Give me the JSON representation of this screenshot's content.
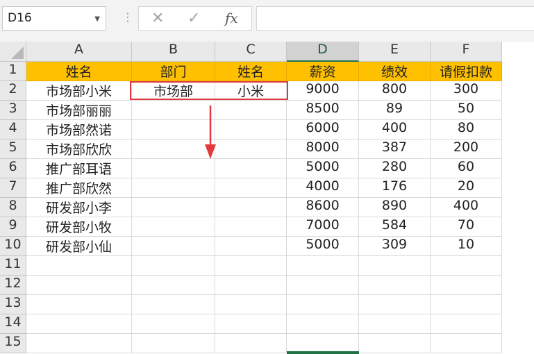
{
  "formula_bar": {
    "name_box": "D16",
    "separator": "⋮",
    "cancel_icon": "✕",
    "enter_icon": "✓",
    "fx_label": "fx",
    "formula": ""
  },
  "columns": [
    "A",
    "B",
    "C",
    "D",
    "E",
    "F"
  ],
  "selected_column": "D",
  "selected_cell": "D16",
  "rows": [
    "1",
    "2",
    "3",
    "4",
    "5",
    "6",
    "7",
    "8",
    "9",
    "10",
    "11",
    "12",
    "13",
    "14",
    "15"
  ],
  "cells": [
    [
      "姓名",
      "部门",
      "姓名",
      "薪资",
      "绩效",
      "请假扣款"
    ],
    [
      "市场部小米",
      "市场部",
      "小米",
      "9000",
      "800",
      "300"
    ],
    [
      "市场部丽丽",
      "",
      "",
      "8500",
      "89",
      "50"
    ],
    [
      "市场部然诺",
      "",
      "",
      "6000",
      "400",
      "80"
    ],
    [
      "市场部欣欣",
      "",
      "",
      "8000",
      "387",
      "200"
    ],
    [
      "推广部耳语",
      "",
      "",
      "5000",
      "280",
      "60"
    ],
    [
      "推广部欣然",
      "",
      "",
      "4000",
      "176",
      "20"
    ],
    [
      "研发部小李",
      "",
      "",
      "8600",
      "890",
      "400"
    ],
    [
      "研发部小牧",
      "",
      "",
      "7000",
      "584",
      "70"
    ],
    [
      "研发部小仙",
      "",
      "",
      "5000",
      "309",
      "10"
    ],
    [
      "",
      "",
      "",
      "",
      "",
      ""
    ],
    [
      "",
      "",
      "",
      "",
      "",
      ""
    ],
    [
      "",
      "",
      "",
      "",
      "",
      ""
    ],
    [
      "",
      "",
      "",
      "",
      "",
      ""
    ],
    [
      "",
      "",
      "",
      "",
      "",
      ""
    ]
  ],
  "colors": {
    "header_fill": "#ffc000",
    "annotation_red": "#e0393e",
    "selection_green": "#217346"
  }
}
